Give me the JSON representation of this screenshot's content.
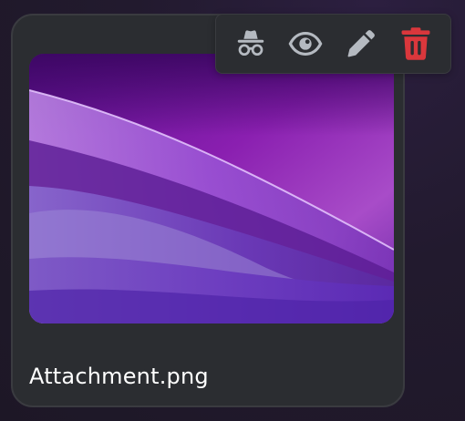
{
  "attachment": {
    "filename": "Attachment.png"
  },
  "toolbar": {
    "buttons": [
      {
        "name": "spoiler",
        "icon": "incognito-icon"
      },
      {
        "name": "view",
        "icon": "eye-icon"
      },
      {
        "name": "edit",
        "icon": "pencil-icon"
      },
      {
        "name": "remove",
        "icon": "trash-icon"
      }
    ]
  },
  "colors": {
    "icon": "#b5bac1",
    "danger": "#da373c",
    "surface": "#2b2d31",
    "text": "#ffffff"
  }
}
